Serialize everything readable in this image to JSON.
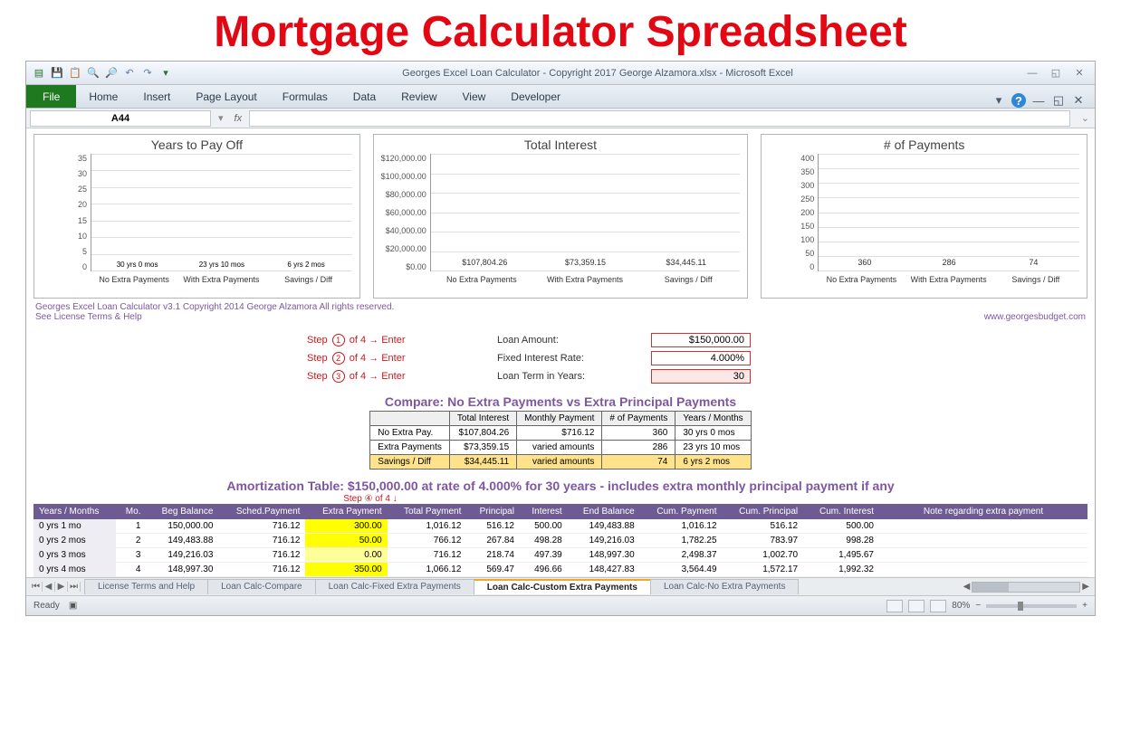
{
  "page_title": "Mortgage Calculator Spreadsheet",
  "window_title": "Georges Excel Loan Calculator -  Copyright 2017 George Alzamora.xlsx  -  Microsoft Excel",
  "ribbon": {
    "file": "File",
    "tabs": [
      "Home",
      "Insert",
      "Page Layout",
      "Formulas",
      "Data",
      "Review",
      "View",
      "Developer"
    ]
  },
  "namebox": "A44",
  "fx_label": "fx",
  "footer": {
    "line1": "Georges Excel Loan Calculator v3.1     Copyright 2014  George Alzamora  All rights reserved.",
    "line2_left": "See License Terms & Help",
    "line2_right": "www.georgesbudget.com"
  },
  "steps": [
    {
      "prefix": "Step",
      "n": "1",
      "of": "of 4 →",
      "action": "Enter",
      "field": "Loan Amount:",
      "value": "$150,000.00"
    },
    {
      "prefix": "Step",
      "n": "2",
      "of": "of 4 →",
      "action": "Enter",
      "field": "Fixed Interest Rate:",
      "value": "4.000%"
    },
    {
      "prefix": "Step",
      "n": "3",
      "of": "of 4 →",
      "action": "Enter",
      "field": "Loan Term in Years:",
      "value": "30"
    }
  ],
  "compare_title": "Compare: No Extra Payments vs Extra Principal Payments",
  "compare_headers": [
    "",
    "Total Interest",
    "Monthly Payment",
    "# of Payments",
    "Years / Months"
  ],
  "compare_rows": [
    {
      "label": "No Extra Pay.",
      "ti": "$107,804.26",
      "mp": "$716.12",
      "np": "360",
      "ym": "30 yrs 0 mos"
    },
    {
      "label": "Extra Payments",
      "ti": "$73,359.15",
      "mp": "varied amounts",
      "np": "286",
      "ym": "23 yrs 10 mos"
    },
    {
      "label": "Savings / Diff",
      "ti": "$34,445.11",
      "mp": "varied amounts",
      "np": "74",
      "ym": "6 yrs 2 mos"
    }
  ],
  "amort_title": "Amortization Table:  $150,000.00 at rate of 4.000% for 30 years - includes extra monthly principal payment if any",
  "step4": "Step ④ of 4 ↓",
  "amort_headers": [
    "Years / Months",
    "Mo.",
    "Beg Balance",
    "Sched.Payment",
    "Extra Payment",
    "Total Payment",
    "Principal",
    "Interest",
    "End Balance",
    "Cum. Payment",
    "Cum. Principal",
    "Cum. Interest",
    "Note regarding extra payment"
  ],
  "amort_rows": [
    {
      "ym": "0 yrs 1 mo",
      "mo": "1",
      "beg": "150,000.00",
      "sched": "716.12",
      "extra": "300.00",
      "tot": "1,016.12",
      "prin": "516.12",
      "int": "500.00",
      "end": "149,483.88",
      "cp": "1,016.12",
      "cprin": "516.12",
      "cint": "500.00"
    },
    {
      "ym": "0 yrs 2 mos",
      "mo": "2",
      "beg": "149,483.88",
      "sched": "716.12",
      "extra": "50.00",
      "tot": "766.12",
      "prin": "267.84",
      "int": "498.28",
      "end": "149,216.03",
      "cp": "1,782.25",
      "cprin": "783.97",
      "cint": "998.28"
    },
    {
      "ym": "0 yrs 3 mos",
      "mo": "3",
      "beg": "149,216.03",
      "sched": "716.12",
      "extra": "0.00",
      "tot": "716.12",
      "prin": "218.74",
      "int": "497.39",
      "end": "148,997.30",
      "cp": "2,498.37",
      "cprin": "1,002.70",
      "cint": "1,495.67"
    },
    {
      "ym": "0 yrs 4 mos",
      "mo": "4",
      "beg": "148,997.30",
      "sched": "716.12",
      "extra": "350.00",
      "tot": "1,066.12",
      "prin": "569.47",
      "int": "496.66",
      "end": "148,427.83",
      "cp": "3,564.49",
      "cprin": "1,572.17",
      "cint": "1,992.32"
    }
  ],
  "sheet_tabs": [
    "License Terms and Help",
    "Loan Calc-Compare",
    "Loan Calc-Fixed Extra Payments",
    "Loan Calc-Custom Extra Payments",
    "Loan Calc-No Extra Payments"
  ],
  "active_tab_index": 3,
  "status": {
    "ready": "Ready",
    "zoom": "80%"
  },
  "chart_data": [
    {
      "type": "bar",
      "title": "Years to Pay Off",
      "ylim": [
        0,
        35
      ],
      "yticks": [
        "35",
        "30",
        "25",
        "20",
        "15",
        "10",
        "5",
        "0"
      ],
      "categories": [
        "No Extra Payments",
        "With Extra Payments",
        "Savings / Diff"
      ],
      "values": [
        30,
        23.83,
        6.17
      ],
      "bar_labels": [
        "30 yrs 0 mos",
        "23 yrs 10 mos",
        "6 yrs 2 mos"
      ],
      "colors": [
        "#f5a623",
        "#a28fc5",
        "#82c341"
      ],
      "label_pos": "inside"
    },
    {
      "type": "bar",
      "title": "Total Interest",
      "ylim": [
        0,
        120000
      ],
      "yticks": [
        "$120,000.00",
        "$100,000.00",
        "$80,000.00",
        "$60,000.00",
        "$40,000.00",
        "$20,000.00",
        "$0.00"
      ],
      "categories": [
        "No Extra Payments",
        "With Extra Payments",
        "Savings / Diff"
      ],
      "values": [
        107804.26,
        73359.15,
        34445.11
      ],
      "bar_labels": [
        "$107,804.26",
        "$73,359.15",
        "$34,445.11"
      ],
      "colors": [
        "#f5a623",
        "#a28fc5",
        "#82c341"
      ],
      "label_pos": "above"
    },
    {
      "type": "bar",
      "title": "# of Payments",
      "ylim": [
        0,
        400
      ],
      "yticks": [
        "400",
        "350",
        "300",
        "250",
        "200",
        "150",
        "100",
        "50",
        "0"
      ],
      "categories": [
        "No Extra Payments",
        "With Extra Payments",
        "Savings / Diff"
      ],
      "values": [
        360,
        286,
        74
      ],
      "bar_labels": [
        "360",
        "286",
        "74"
      ],
      "colors": [
        "#f5a623",
        "#a28fc5",
        "#82c341"
      ],
      "label_pos": "above"
    }
  ]
}
